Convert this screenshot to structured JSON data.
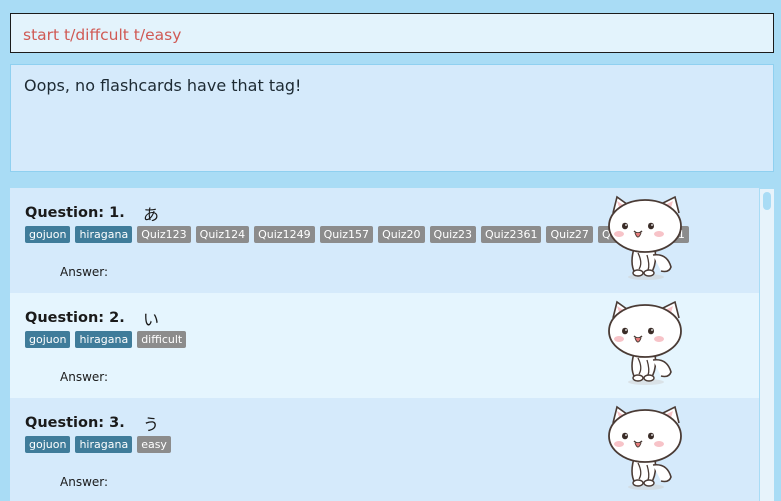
{
  "command": {
    "value": "start t/diffcult t/easy"
  },
  "result": {
    "message": "Oops, no flashcards have that tag!"
  },
  "answer_label": "Answer:",
  "cards": [
    {
      "title": "Question: 1.",
      "kana": "あ",
      "tags": [
        {
          "label": "gojuon",
          "style": "blue"
        },
        {
          "label": "hiragana",
          "style": "blue"
        },
        {
          "label": "Quiz123",
          "style": "grey"
        },
        {
          "label": "Quiz124",
          "style": "grey"
        },
        {
          "label": "Quiz1249",
          "style": "grey"
        },
        {
          "label": "Quiz157",
          "style": "grey"
        },
        {
          "label": "Quiz20",
          "style": "grey"
        },
        {
          "label": "Quiz23",
          "style": "grey"
        },
        {
          "label": "Quiz2361",
          "style": "grey"
        },
        {
          "label": "Quiz27",
          "style": "grey"
        },
        {
          "label": "Quiz3",
          "style": "grey"
        },
        {
          "label": "Quiz41",
          "style": "grey"
        }
      ]
    },
    {
      "title": "Question: 2.",
      "kana": "い",
      "tags": [
        {
          "label": "gojuon",
          "style": "blue"
        },
        {
          "label": "hiragana",
          "style": "blue"
        },
        {
          "label": "difficult",
          "style": "grey"
        }
      ]
    },
    {
      "title": "Question: 3.",
      "kana": "う",
      "tags": [
        {
          "label": "gojuon",
          "style": "blue"
        },
        {
          "label": "hiragana",
          "style": "blue"
        },
        {
          "label": "easy",
          "style": "grey"
        }
      ]
    }
  ],
  "colors": {
    "tag_blue": "#3f7c9a",
    "tag_grey": "#8c8c8c",
    "command_text": "#d05a55"
  },
  "icons": {
    "card_image": "white-cat-icon"
  }
}
